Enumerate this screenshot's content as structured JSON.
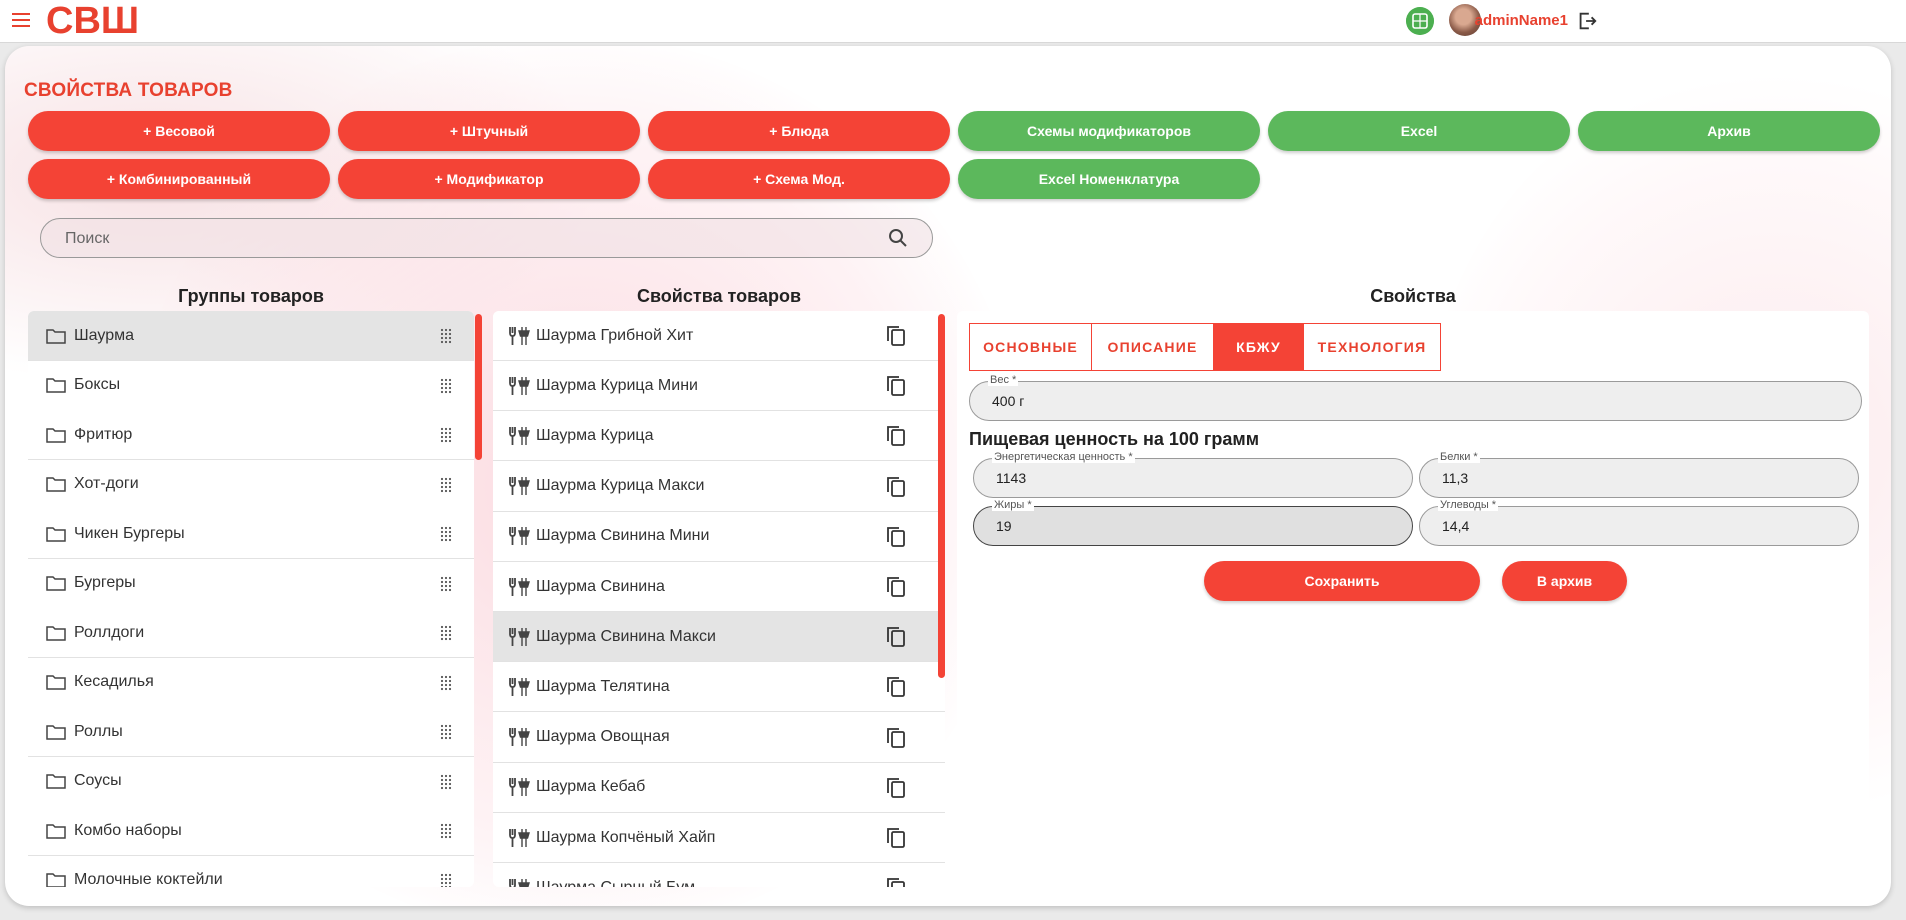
{
  "app": {
    "logo_text": "СВШ",
    "username": "adminName1"
  },
  "page": {
    "title": "СВОЙСТВА ТОВАРОВ"
  },
  "buttons": {
    "row1": [
      {
        "label": "+ Весовой",
        "color": "red"
      },
      {
        "label": "+ Штучный",
        "color": "red"
      },
      {
        "label": "+ Блюда",
        "color": "red"
      },
      {
        "label": "Схемы модификаторов",
        "color": "green"
      },
      {
        "label": "Excel",
        "color": "green"
      },
      {
        "label": "Архив",
        "color": "green"
      }
    ],
    "row2": [
      {
        "label": "+ Комбинированный",
        "color": "red"
      },
      {
        "label": "+ Модификатор",
        "color": "red"
      },
      {
        "label": "+ Схема Мод.",
        "color": "red"
      },
      {
        "label": "Excel Номенклатура",
        "color": "green"
      }
    ]
  },
  "search": {
    "placeholder": "Поиск"
  },
  "groups": {
    "title": "Группы товаров",
    "items": [
      "Шаурма",
      "Боксы",
      "Фритюр",
      "Хот-доги",
      "Чикен Бургеры",
      "Бургеры",
      "Роллдоги",
      "Кесадилья",
      "Роллы",
      "Соусы",
      "Комбо наборы",
      "Молочные коктейли"
    ],
    "selected_index": 0
  },
  "products": {
    "title": "Свойства товаров",
    "items": [
      "Шаурма Грибной Хит",
      "Шаурма Курица Мини",
      "Шаурма Курица",
      "Шаурма Курица Макси",
      "Шаурма Свинина Мини",
      "Шаурма Свинина",
      "Шаурма Свинина Макси",
      "Шаурма Телятина",
      "Шаурма Овощная",
      "Шаурма Кебаб",
      "Шаурма Копчёный Хайп",
      "Шаурма Сырный Бум"
    ],
    "selected_index": 6
  },
  "properties": {
    "title": "Свойства",
    "tabs": [
      "ОСНОВНЫЕ",
      "ОПИСАНИЕ",
      "КБЖУ",
      "ТЕХНОЛОГИЯ"
    ],
    "active_tab": 2,
    "weight": {
      "label": "Вес *",
      "value": "400 г"
    },
    "nutrition_heading": "Пищевая ценность на 100 грамм",
    "energy": {
      "label": "Энергетическая ценность *",
      "value": "1143"
    },
    "protein": {
      "label": "Белки *",
      "value": "11,3"
    },
    "fat": {
      "label": "Жиры *",
      "value": "19"
    },
    "carbs": {
      "label": "Углеводы *",
      "value": "14,4"
    },
    "save_label": "Сохранить",
    "archive_label": "В архив"
  },
  "colors": {
    "accent_red": "#f44336",
    "accent_green": "#5cb85c",
    "brand_red": "#e8412f"
  }
}
